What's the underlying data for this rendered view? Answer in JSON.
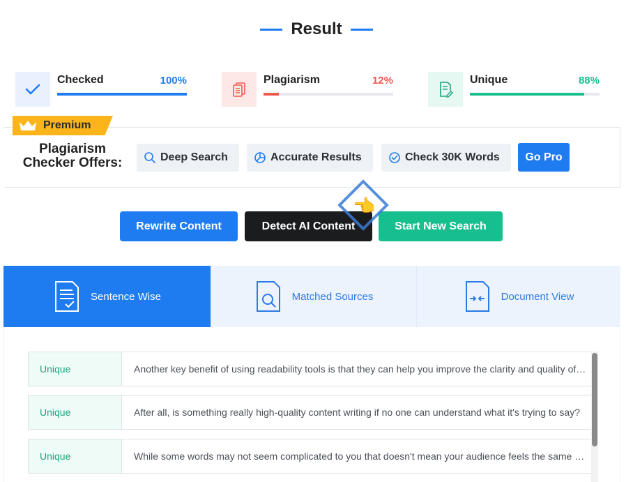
{
  "header": {
    "title": "Result"
  },
  "stats": [
    {
      "label": "Checked",
      "percent_text": "100%",
      "fill": 1.0,
      "color": "#1f7cf0",
      "icon": "checkmark-icon",
      "icon_bg": "#e8f1fd"
    },
    {
      "label": "Plagiarism",
      "percent_text": "12%",
      "fill": 0.12,
      "color": "#f2574f",
      "icon": "copy-documents-icon",
      "icon_bg": "#fde8e6"
    },
    {
      "label": "Unique",
      "percent_text": "88%",
      "fill": 0.88,
      "color": "#17bf8f",
      "icon": "edit-document-icon",
      "icon_bg": "#e5f8f2"
    }
  ],
  "premium": {
    "badge_label": "Premium",
    "heading_line1": "Plagiarism",
    "heading_line2": "Checker Offers:",
    "features": [
      {
        "label": "Deep Search",
        "icon": "search-icon"
      },
      {
        "label": "Accurate Results",
        "icon": "pie-chart-icon"
      },
      {
        "label": "Check 30K Words",
        "icon": "check-circle-icon"
      }
    ],
    "go_pro_label": "Go Pro",
    "accent_color": "#fbb51a"
  },
  "actions": {
    "rewrite_label": "Rewrite Content",
    "detect_label": "Detect AI Content",
    "new_search_label": "Start New Search"
  },
  "tabs": [
    {
      "label": "Sentence Wise",
      "icon": "sentence-document-icon",
      "active": true
    },
    {
      "label": "Matched Sources",
      "icon": "search-document-icon",
      "active": false
    },
    {
      "label": "Document View",
      "icon": "compare-document-icon",
      "active": false
    }
  ],
  "results": [
    {
      "tag": "Unique",
      "text": "Another key benefit of using readability tools is that they can help you improve the clarity and quality of your content."
    },
    {
      "tag": "Unique",
      "text": "After all, is something really high-quality content writing if no one can understand what it's trying to say?"
    },
    {
      "tag": "Unique",
      "text": "While some words may not seem complicated to you that doesn't mean your audience feels the same way."
    }
  ]
}
